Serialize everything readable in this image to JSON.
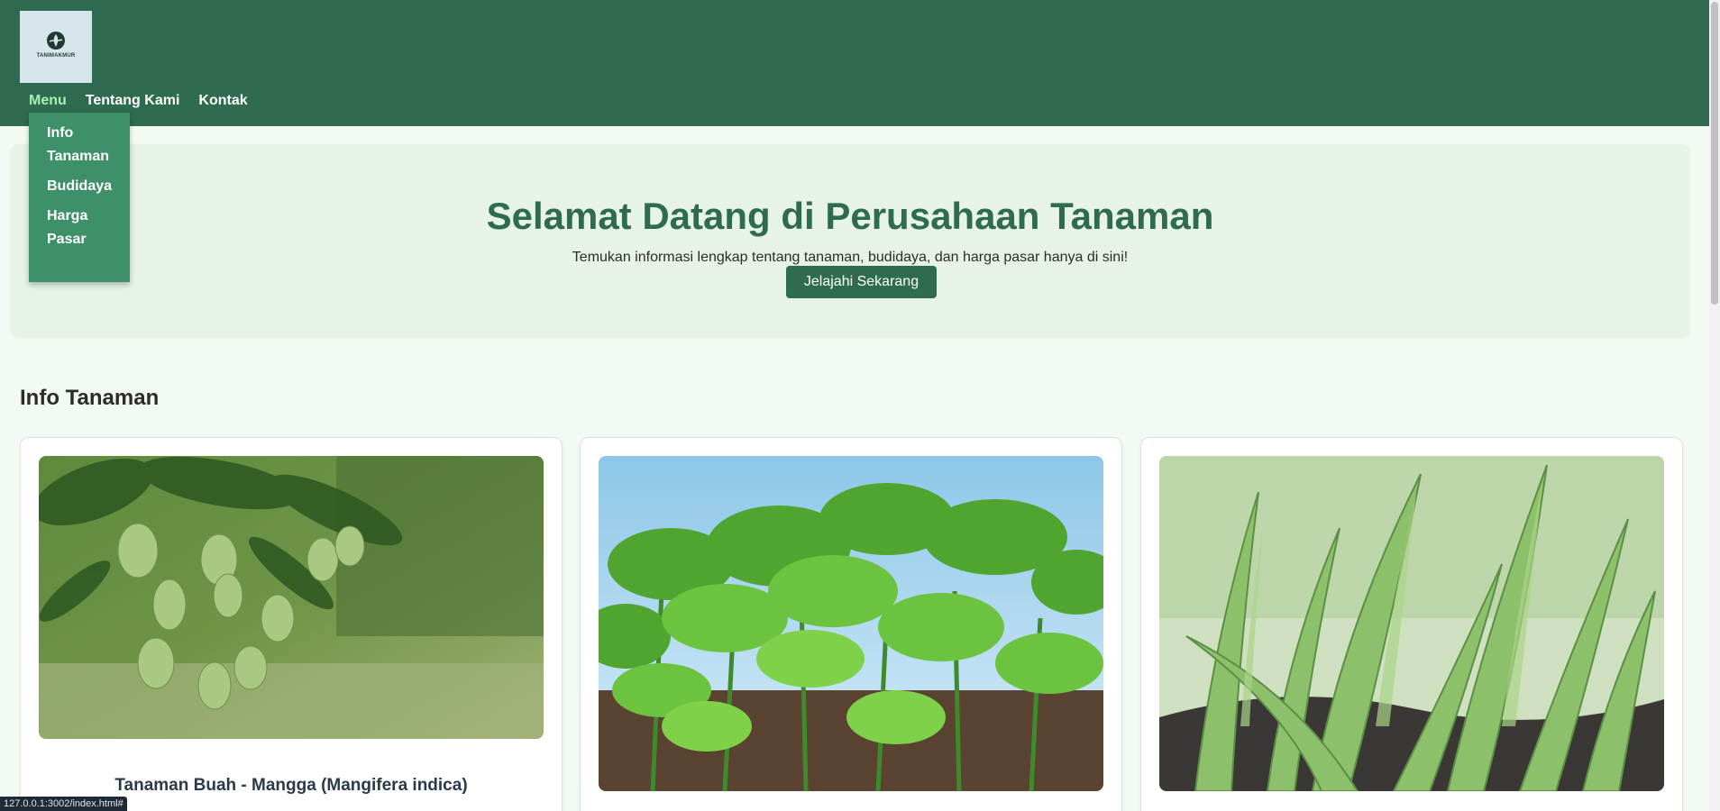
{
  "header": {
    "logo_text": "TANIMAKMUR",
    "nav": [
      {
        "label": "Menu"
      },
      {
        "label": "Tentang Kami"
      },
      {
        "label": "Kontak"
      }
    ]
  },
  "dropdown": {
    "items": [
      {
        "label": "Info Tanaman"
      },
      {
        "label": "Budidaya"
      },
      {
        "label": "Harga Pasar"
      }
    ]
  },
  "hero": {
    "title": "Selamat Datang di Perusahaan Tanaman",
    "subtitle": "Temukan informasi lengkap tentang tanaman, budidaya, dan harga pasar hanya di sini!",
    "button_label": "Jelajahi Sekarang"
  },
  "section": {
    "title": "Info Tanaman"
  },
  "cards": [
    {
      "title": "Tanaman Buah - Mangga (Mangifera indica)"
    },
    {
      "title": ""
    },
    {
      "title": ""
    }
  ],
  "status_bar": {
    "url": "127.0.0.1:3002/index.html#"
  },
  "colors": {
    "primary": "#2e6b50",
    "nav_active": "#a6f0b4",
    "dropdown_bg": "#3e9068",
    "hero_bg": "#e6f3e6",
    "page_bg": "#f3faf3"
  }
}
